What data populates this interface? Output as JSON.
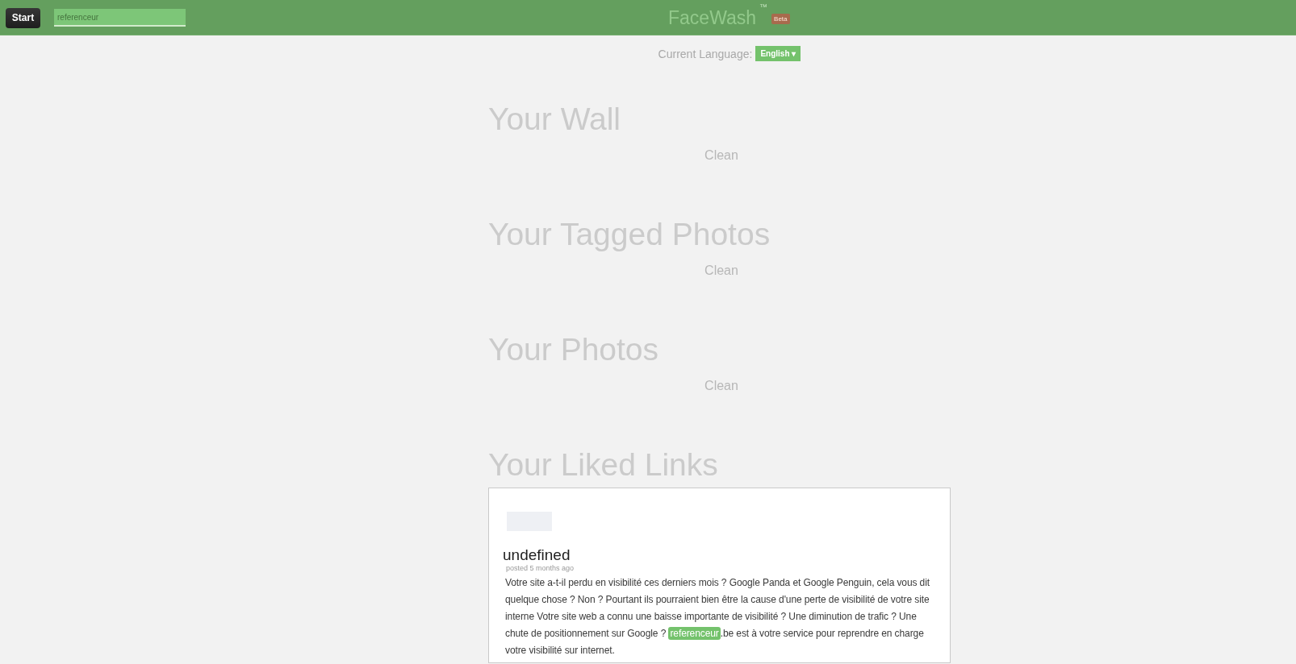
{
  "top_bar": {
    "start_button": "Start",
    "search": {
      "value": "referenceur"
    },
    "title": "FaceWash",
    "trademark": "™",
    "badge": "Beta"
  },
  "language": {
    "label": "Current Language:",
    "button": "English ▾"
  },
  "sections": [
    {
      "kind": "status",
      "title": "Your Wall",
      "status": "Clean"
    },
    {
      "kind": "status",
      "title": "Your Tagged Photos",
      "status": "Clean"
    },
    {
      "kind": "status",
      "title": "Your Photos",
      "status": "Clean"
    },
    {
      "kind": "posts",
      "title": "Your Liked Links",
      "posts": [
        {
          "title": "undefined",
          "meta": "posted 5 months ago",
          "body": [
            {
              "text": "Votre site a-t-il perdu en visibilité ces derniers mois ? Google Panda et Google Penguin, cela vous dit quelque chose ? Non ? Pourtant ils pourraient bien être la cause d'une perte de visibilité de votre site interne Votre site web a connu une baisse importante de visibilité ? Une diminution de trafic ? Une chute de positionnement sur Google ? ",
              "highlighted": false
            },
            {
              "text": "referenceur",
              "highlighted": true
            },
            {
              "text": ".be est à votre service pour reprendre en charge votre visibilité sur internet.",
              "highlighted": false
            }
          ]
        }
      ]
    }
  ]
}
